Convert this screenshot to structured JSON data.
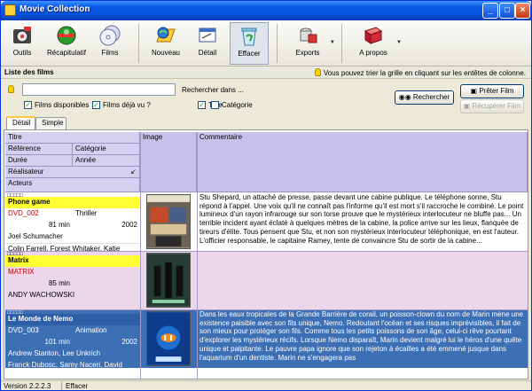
{
  "window": {
    "title": "Movie Collection"
  },
  "toolbar": {
    "buttons": [
      {
        "label": "Outils",
        "icon": "tools-icon"
      },
      {
        "label": "Récapitulatif",
        "icon": "summary-icon"
      },
      {
        "label": "Films",
        "icon": "films-icon"
      },
      {
        "label": "Nouveau",
        "icon": "new-icon"
      },
      {
        "label": "Détail",
        "icon": "detail-icon"
      },
      {
        "label": "Effacer",
        "icon": "erase-icon"
      },
      {
        "label": "Exports",
        "icon": "exports-icon"
      },
      {
        "label": "A propos",
        "icon": "about-icon"
      }
    ]
  },
  "section": {
    "title": "Liste des films",
    "hint": "Vous pouvez trier la grille en cliquant sur les entêtes de colonne."
  },
  "search": {
    "value": "",
    "label": "Rechercher dans ...",
    "opt_films_disponibles": "Films disponibles",
    "opt_films_vus": "Films déjà vu ?",
    "opt_titre": "Titre",
    "opt_categorie": "Catégorie",
    "search_button": "Rechercher",
    "preter_button": "Prêter Film",
    "recuperer_button": "Récupérer Film"
  },
  "tabs": [
    {
      "label": "Détail"
    },
    {
      "label": "Simple"
    }
  ],
  "grid": {
    "headers": {
      "titre": "Titre",
      "reference": "Référence",
      "categorie": "Catégorie",
      "duree": "Durée",
      "annee": "Année",
      "realisateur": "Réalisateur",
      "acteurs": "Acteurs",
      "image": "Image",
      "commentaire": "Commentaire"
    },
    "rows": [
      {
        "stars": "□□□□□",
        "title": "Phone game",
        "reference": "DVD_002",
        "category": "Thriller",
        "duration": "81 min",
        "year": "2002",
        "director": "Joel Schumacher",
        "actors": "Colin Farrell, Forest Whitaker, Katie",
        "comment": "Stu Shepard, un attaché de presse, passe devant une cabine publique. Le téléphone sonne, Stu répond à l'appel. Une voix qu'il ne connaît pas l'informe qu'il est mort s'il raccroche le combiné. Le point lumineux d'un rayon infrarouge sur son torse prouve que le mystérieux interlocuteur ne bluffe pas... Un terrible incident ayant éclaté à quelques mètres de la cabine, la police arrive sur les lieux, flanquée de tireurs d'élite. Tous pensent que Stu, et non son mystérieux interlocuteur téléphonique, en est l'auteur. L'officier responsable, le capitaine Ramey, tente de convaincre Stu de sortir de la cabine..."
      },
      {
        "stars": "□□□□□",
        "title": "Matrix",
        "reference": "MATRIX",
        "category": "",
        "duration": "85 min",
        "year": "",
        "director": "ANDY WACHOWSKI",
        "actors": "",
        "comment": ""
      },
      {
        "stars": "□□□□□",
        "title": "Le Monde de Nemo",
        "reference": "DVD_003",
        "category": "Animation",
        "duration": "101 min",
        "year": "2002",
        "director": "Andrew Stanton, Lee Unkrich",
        "actors": "Franck Dubosc, Samy Naceri, David",
        "comment": "Dans les eaux tropicales de la Grande Barrière de corail, un poisson-clown du nom de Marin mène une existence paisible avec son fils unique, Nemo. Redoutant l'océan et ses risques imprévisibles, il fait de son mieux pour protéger son fils. Comme tous les petits poissons de son âge, celui-ci rêve pourtant d'explorer les mystérieux récifs. Lorsque Nemo disparaît, Marin devient malgré lui le héros d'une quête unique et palpitante. Le pauvre papa ignore que son rejeton à écailles a été emmené jusque dans l'aquarium d'un dentiste. Marin ne s'engagera pas"
      }
    ]
  },
  "status": {
    "version": "Version 2.2.2.3",
    "message": "Effacer"
  },
  "colors": {
    "title_bar": "#0a5ae6",
    "row_highlight": "#ffff33",
    "selected_row": "#3d6fb5",
    "header_bg": "#c8c0ea",
    "even_row": "#ebd6ea"
  }
}
